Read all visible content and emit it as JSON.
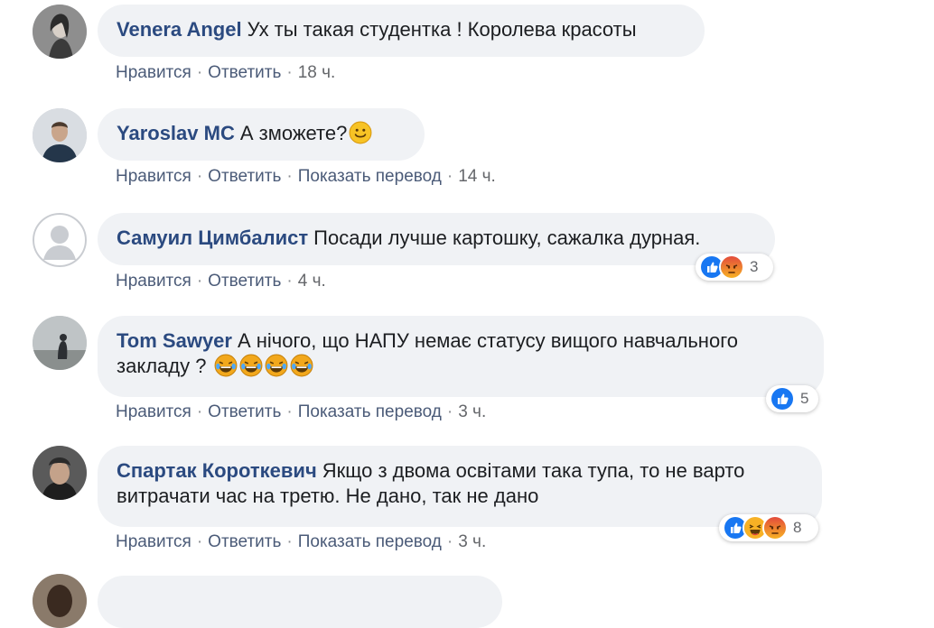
{
  "actions": {
    "like": "Нравится",
    "reply": "Ответить",
    "translate": "Показать перевод",
    "separator": "·"
  },
  "comments": [
    {
      "author": "Venera Angel",
      "text": "Ух ты такая студентка ! Королева красоты",
      "time": "18 ч."
    },
    {
      "author": "Yaroslav MC",
      "text": "А зможете?",
      "time": "14 ч."
    },
    {
      "author": "Самуил Цимбалист",
      "text": "Посади лучше картошку, сажалка дурная.",
      "time": "4 ч.",
      "reactions": "3"
    },
    {
      "author": "Tom Sawyer",
      "text": "А нічого, що НАПУ немає статусу вищого навчального закладу ?",
      "time": "3 ч.",
      "reactions": "5"
    },
    {
      "author": "Спартак Короткевич",
      "text": "Якщо з двома освітами така тупа, то не варто витрачати час на третю. Не дано, так не дано",
      "time": "3 ч.",
      "reactions": "8"
    }
  ],
  "colors": {
    "like": "#1877f2",
    "angry": "#e9710f",
    "haha": "#f7b125"
  }
}
